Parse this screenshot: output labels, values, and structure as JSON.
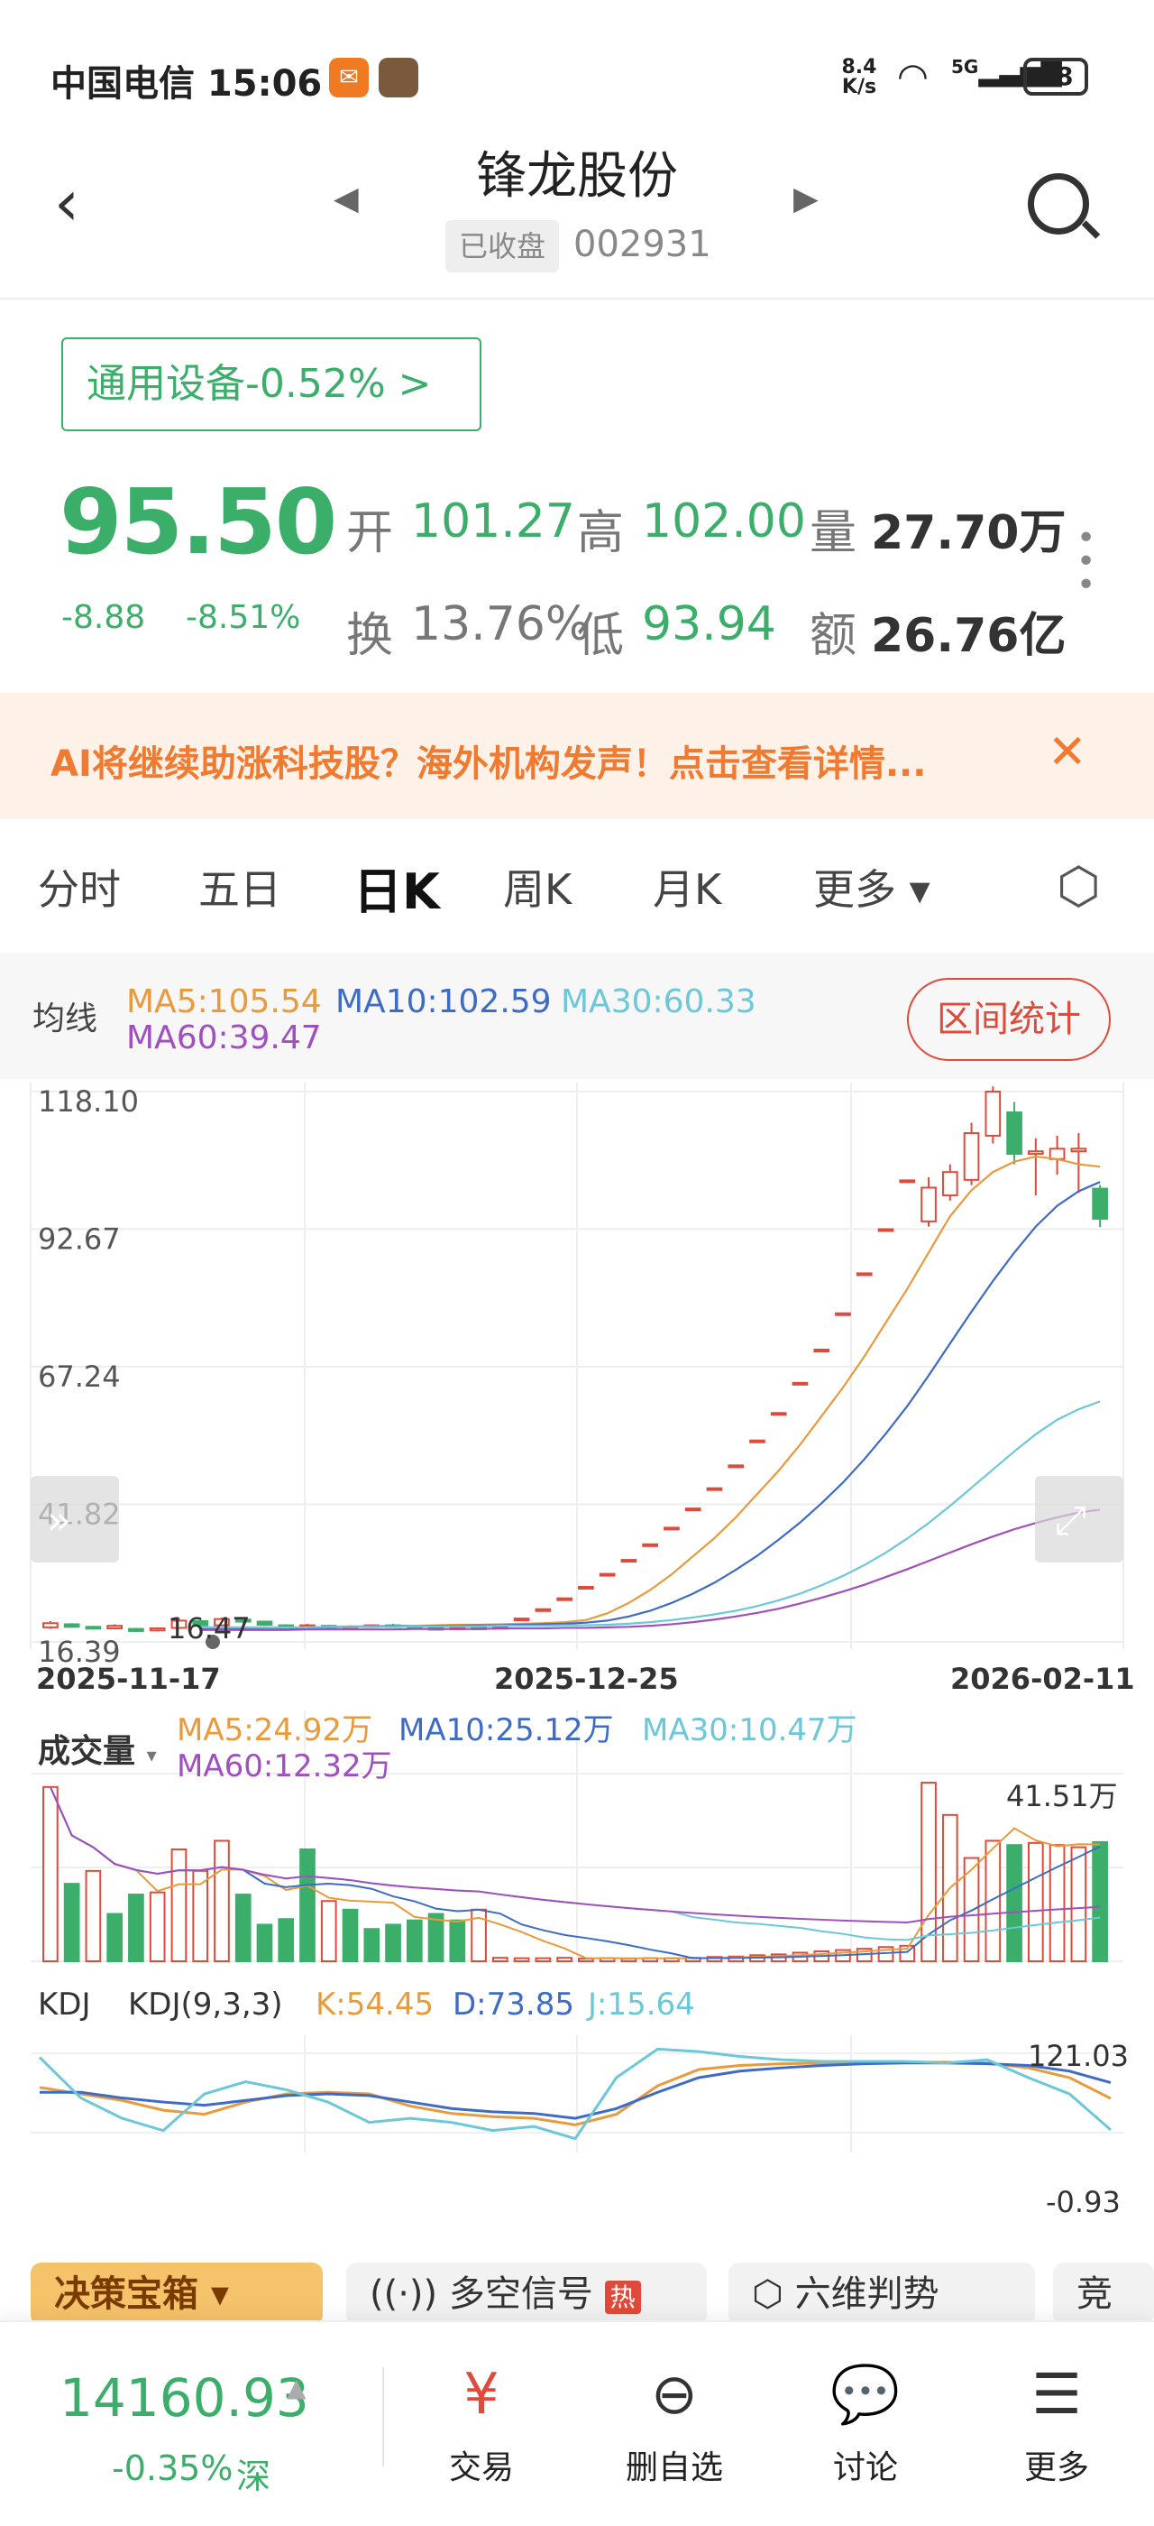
{
  "status_bar": {
    "carrier_time": "中国电信 15:06",
    "net_speed_top": "8.4",
    "net_speed_bottom": "K/s",
    "signal": "5G",
    "battery": "88"
  },
  "header": {
    "title": "锋龙股份",
    "market_status": "已收盘",
    "code": "002931"
  },
  "sector_tag": "通用设备-0.52% >",
  "quote": {
    "price": "95.50",
    "change": "-8.88",
    "change_pct": "-8.51%",
    "open_label": "开",
    "open": "101.27",
    "high_label": "高",
    "high": "102.00",
    "volume_label": "量",
    "volume": "27.70万",
    "turnover_label": "换",
    "turnover": "13.76%",
    "low_label": "低",
    "low": "93.94",
    "amount_label": "额",
    "amount": "26.76亿"
  },
  "banner": {
    "text": "AI将继续助涨科技股？海外机构发声！点击查看详情...",
    "close": "✕"
  },
  "tabs": [
    "分时",
    "五日",
    "日K",
    "周K",
    "月K",
    "更多 ▾"
  ],
  "active_tab": "日K",
  "ma_legend": {
    "label": "均线",
    "ma5": "MA5:105.54",
    "ma10": "MA10:102.59",
    "ma30": "MA30:60.33",
    "ma60": "MA60:39.47",
    "range_button": "区间统计"
  },
  "colors": {
    "up": "#e04a3a",
    "down": "#3bae6a",
    "ma5": "#e89a3c",
    "ma10": "#3d6bc6",
    "ma30": "#6cc8d8",
    "ma60": "#a04fbf"
  },
  "chart_data": [
    {
      "type": "line",
      "title": "",
      "y_ticks": [
        "118.10",
        "92.67",
        "67.24",
        "41.82",
        "16.39"
      ],
      "ylim": [
        14.0,
        120.0
      ],
      "x_ticks": [
        "2025-11-17",
        "2025-12-25",
        "2026-02-11"
      ],
      "min_label": "16.47",
      "series": [
        {
          "name": "MA5",
          "values": [
            16.4,
            16.5,
            16.6,
            16.7,
            16.6,
            16.8,
            16.9,
            17.0,
            17.0,
            17.1,
            17.1,
            17.2,
            17.3,
            17.3,
            17.4,
            17.5,
            17.6,
            17.8,
            18.2,
            19.5,
            21.5,
            24.0,
            27.0,
            30.5,
            34.0,
            38.0,
            42.5,
            47.0,
            52.0,
            57.5,
            63.0,
            69.0,
            75.5,
            82.0,
            89.0,
            96.0,
            101.0,
            104.5,
            106.5,
            107.5,
            107.0,
            106.0,
            105.54
          ]
        },
        {
          "name": "MA10",
          "values": [
            16.6,
            16.6,
            16.6,
            16.7,
            16.7,
            16.7,
            16.8,
            16.9,
            16.9,
            17.0,
            17.0,
            17.1,
            17.1,
            17.2,
            17.2,
            17.3,
            17.4,
            17.5,
            17.7,
            18.1,
            18.9,
            20.0,
            21.5,
            23.3,
            25.4,
            27.9,
            30.6,
            33.7,
            37.0,
            40.7,
            44.7,
            49.2,
            54.1,
            59.4,
            65.3,
            71.5,
            77.6,
            83.5,
            89.0,
            94.0,
            98.0,
            100.8,
            102.59
          ]
        },
        {
          "name": "MA30",
          "values": [
            16.8,
            16.8,
            16.8,
            16.8,
            16.8,
            16.8,
            16.9,
            16.9,
            16.9,
            16.9,
            17.0,
            17.0,
            17.0,
            17.0,
            17.1,
            17.1,
            17.1,
            17.2,
            17.2,
            17.3,
            17.5,
            17.8,
            18.2,
            18.7,
            19.3,
            20.0,
            20.9,
            22.0,
            23.3,
            24.9,
            26.7,
            28.8,
            31.2,
            33.9,
            36.9,
            40.2,
            43.7,
            47.2,
            50.7,
            54.0,
            56.8,
            58.8,
            60.33
          ]
        },
        {
          "name": "MA60",
          "values": [
            16.3,
            16.3,
            16.3,
            16.3,
            16.3,
            16.4,
            16.4,
            16.4,
            16.4,
            16.4,
            16.5,
            16.5,
            16.5,
            16.5,
            16.6,
            16.6,
            16.6,
            16.7,
            16.7,
            16.8,
            16.9,
            17.1,
            17.4,
            17.8,
            18.3,
            18.9,
            19.6,
            20.4,
            21.4,
            22.5,
            23.7,
            25.0,
            26.5,
            28.0,
            29.6,
            31.2,
            32.8,
            34.3,
            35.7,
            36.9,
            38.0,
            38.9,
            39.47
          ]
        }
      ],
      "candles": [
        {
          "o": 16.8,
          "c": 17.6,
          "h": 18.0,
          "l": 16.5
        },
        {
          "o": 17.4,
          "c": 16.9,
          "h": 17.6,
          "l": 16.7
        },
        {
          "o": 16.9,
          "c": 16.6,
          "h": 17.1,
          "l": 16.4
        },
        {
          "o": 16.6,
          "c": 17.1,
          "h": 17.4,
          "l": 16.5
        },
        {
          "o": 16.5,
          "c": 16.1,
          "h": 16.7,
          "l": 15.9
        },
        {
          "o": 16.2,
          "c": 16.6,
          "h": 16.8,
          "l": 16.0
        },
        {
          "o": 16.7,
          "c": 18.1,
          "h": 18.6,
          "l": 16.6
        },
        {
          "o": 18.0,
          "c": 17.2,
          "h": 18.2,
          "l": 17.0
        },
        {
          "o": 17.2,
          "c": 18.4,
          "h": 18.7,
          "l": 17.1
        },
        {
          "o": 18.3,
          "c": 17.9,
          "h": 18.6,
          "l": 17.6
        },
        {
          "o": 17.9,
          "c": 17.3,
          "h": 18.1,
          "l": 17.1
        },
        {
          "o": 17.2,
          "c": 16.9,
          "h": 17.4,
          "l": 16.7
        },
        {
          "o": 16.9,
          "c": 17.2,
          "h": 17.5,
          "l": 16.8
        },
        {
          "o": 17.1,
          "c": 16.8,
          "h": 17.3,
          "l": 16.5
        },
        {
          "o": 16.8,
          "c": 16.9,
          "h": 17.2,
          "l": 16.6
        },
        {
          "o": 16.9,
          "c": 17.2,
          "h": 17.4,
          "l": 16.7
        },
        {
          "o": 17.2,
          "c": 17.0,
          "h": 17.5,
          "l": 16.9
        },
        {
          "o": 17.0,
          "c": 16.7,
          "h": 17.2,
          "l": 16.5
        },
        {
          "o": 16.7,
          "c": 16.4,
          "h": 16.9,
          "l": 16.2
        },
        {
          "o": 16.5,
          "c": 16.8,
          "h": 17.0,
          "l": 16.3
        },
        {
          "o": 16.8,
          "c": 16.6,
          "h": 17.0,
          "l": 16.4
        },
        {
          "o": 16.6,
          "c": 16.9,
          "h": 17.1,
          "l": 16.4
        },
        {
          "o": 18.5,
          "c": 18.5,
          "h": 18.6,
          "l": 18.4
        },
        {
          "o": 20.3,
          "c": 20.3,
          "h": 20.4,
          "l": 20.2
        },
        {
          "o": 22.4,
          "c": 22.4,
          "h": 22.5,
          "l": 22.3
        },
        {
          "o": 24.6,
          "c": 24.6,
          "h": 24.7,
          "l": 24.5
        },
        {
          "o": 27.1,
          "c": 27.1,
          "h": 27.2,
          "l": 27.0
        },
        {
          "o": 29.8,
          "c": 29.8,
          "h": 29.9,
          "l": 29.7
        },
        {
          "o": 32.8,
          "c": 32.8,
          "h": 32.9,
          "l": 32.7
        },
        {
          "o": 36.0,
          "c": 36.0,
          "h": 36.1,
          "l": 35.9
        },
        {
          "o": 39.7,
          "c": 39.7,
          "h": 39.8,
          "l": 39.6
        },
        {
          "o": 43.6,
          "c": 43.6,
          "h": 43.7,
          "l": 43.5
        },
        {
          "o": 48.0,
          "c": 48.0,
          "h": 48.1,
          "l": 47.9
        },
        {
          "o": 52.8,
          "c": 52.8,
          "h": 52.9,
          "l": 52.7
        },
        {
          "o": 58.1,
          "c": 58.1,
          "h": 58.2,
          "l": 58.0
        },
        {
          "o": 63.9,
          "c": 63.9,
          "h": 64.0,
          "l": 63.8
        },
        {
          "o": 70.3,
          "c": 70.3,
          "h": 70.4,
          "l": 70.2
        },
        {
          "o": 77.3,
          "c": 77.3,
          "h": 77.4,
          "l": 77.2
        },
        {
          "o": 85.0,
          "c": 85.0,
          "h": 85.1,
          "l": 84.9
        },
        {
          "o": 93.5,
          "c": 93.5,
          "h": 93.6,
          "l": 93.4
        },
        {
          "o": 102.9,
          "c": 102.9,
          "h": 103.0,
          "l": 102.8
        },
        {
          "o": 95.0,
          "c": 101.5,
          "h": 103.5,
          "l": 94.0
        },
        {
          "o": 100.0,
          "c": 104.5,
          "h": 106.0,
          "l": 99.0
        },
        {
          "o": 103.0,
          "c": 112.0,
          "h": 114.0,
          "l": 102.0
        },
        {
          "o": 111.5,
          "c": 120.0,
          "h": 121.0,
          "l": 110.0
        },
        {
          "o": 116.0,
          "c": 108.0,
          "h": 118.0,
          "l": 106.0
        },
        {
          "o": 108.0,
          "c": 108.5,
          "h": 111.0,
          "l": 100.0
        },
        {
          "o": 107.0,
          "c": 109.0,
          "h": 111.5,
          "l": 104.0
        },
        {
          "o": 108.5,
          "c": 109.0,
          "h": 112.0,
          "l": 100.5
        },
        {
          "o": 101.3,
          "c": 95.5,
          "h": 102.0,
          "l": 93.9
        }
      ]
    },
    {
      "type": "bar",
      "title": "成交量",
      "legend": {
        "ma5": "MA5:24.92万",
        "ma10": "MA10:25.12万",
        "ma30": "MA30:10.47万",
        "ma60": "MA60:12.32万"
      },
      "max_label": "41.51万",
      "ylim": [
        0,
        41.51
      ],
      "values": [
        40.5,
        18.0,
        21.0,
        11.0,
        15.5,
        16.0,
        26.0,
        21.0,
        28.0,
        15.5,
        8.5,
        9.8,
        26.0,
        14.0,
        12.0,
        7.5,
        8.5,
        9.5,
        11.0,
        9.5,
        12.0,
        0.8,
        0.7,
        0.7,
        0.8,
        0.6,
        0.7,
        0.6,
        0.7,
        0.7,
        0.8,
        1.0,
        1.1,
        1.4,
        1.6,
        2.0,
        2.3,
        2.6,
        2.9,
        3.3,
        3.6,
        41.5,
        34.0,
        24.0,
        28.0,
        27.0,
        27.5,
        27.0,
        26.5,
        27.7
      ],
      "up": [
        true,
        false,
        true,
        false,
        false,
        true,
        true,
        true,
        true,
        false,
        false,
        false,
        false,
        true,
        false,
        false,
        false,
        false,
        false,
        false,
        true,
        true,
        true,
        true,
        true,
        true,
        true,
        true,
        true,
        true,
        true,
        true,
        true,
        true,
        true,
        true,
        true,
        true,
        true,
        true,
        true,
        true,
        true,
        true,
        true,
        false,
        true,
        true,
        true,
        false
      ]
    },
    {
      "type": "line",
      "title": "KDJ",
      "params": "KDJ(9,3,3)",
      "k": "K:54.45",
      "d": "D:73.85",
      "j": "J:15.64",
      "ylim": [
        -0.93,
        121.03
      ],
      "y_ticks": [
        "121.03",
        "-0.93"
      ],
      "series": [
        {
          "name": "K",
          "values": [
            68,
            60,
            52,
            40,
            35,
            50,
            60,
            62,
            60,
            45,
            36,
            32,
            30,
            22,
            35,
            70,
            90,
            95,
            97,
            98,
            99,
            99,
            99,
            98,
            92,
            80,
            54.45
          ]
        },
        {
          "name": "D",
          "values": [
            62,
            62,
            55,
            50,
            46,
            52,
            58,
            60,
            58,
            50,
            42,
            38,
            36,
            30,
            42,
            62,
            80,
            88,
            92,
            95,
            97,
            98,
            98,
            97,
            95,
            88,
            73.85
          ]
        },
        {
          "name": "J",
          "values": [
            105,
            55,
            30,
            15,
            60,
            75,
            65,
            50,
            25,
            30,
            25,
            15,
            20,
            5,
            80,
            115,
            112,
            106,
            102,
            100,
            100,
            100,
            98,
            102,
            80,
            60,
            15.64
          ]
        }
      ]
    }
  ],
  "bottom_pills": [
    "决策宝箱 ▾",
    "多空信号",
    "热",
    "六维判势",
    "竞"
  ],
  "bottom_bar": {
    "index_value": "14160.93",
    "index_arrow": "▲",
    "index_change": "-0.35%",
    "index_market": "深",
    "items": [
      "交易",
      "删自选",
      "讨论",
      "更多"
    ]
  }
}
